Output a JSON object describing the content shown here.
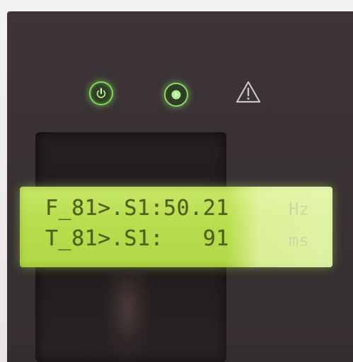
{
  "indicators": {
    "power_icon": "power-icon",
    "run_icon": "run-icon",
    "warning_icon": "warning-icon",
    "led_color": "#7bdc55"
  },
  "lcd": {
    "background_color": "#b8df4e",
    "text_color": "#50601c",
    "line1": {
      "text": "F_81>.S1:50.21",
      "unit": "Hz"
    },
    "line2": {
      "text": "T_81>.S1:   91",
      "unit": "ms"
    }
  }
}
